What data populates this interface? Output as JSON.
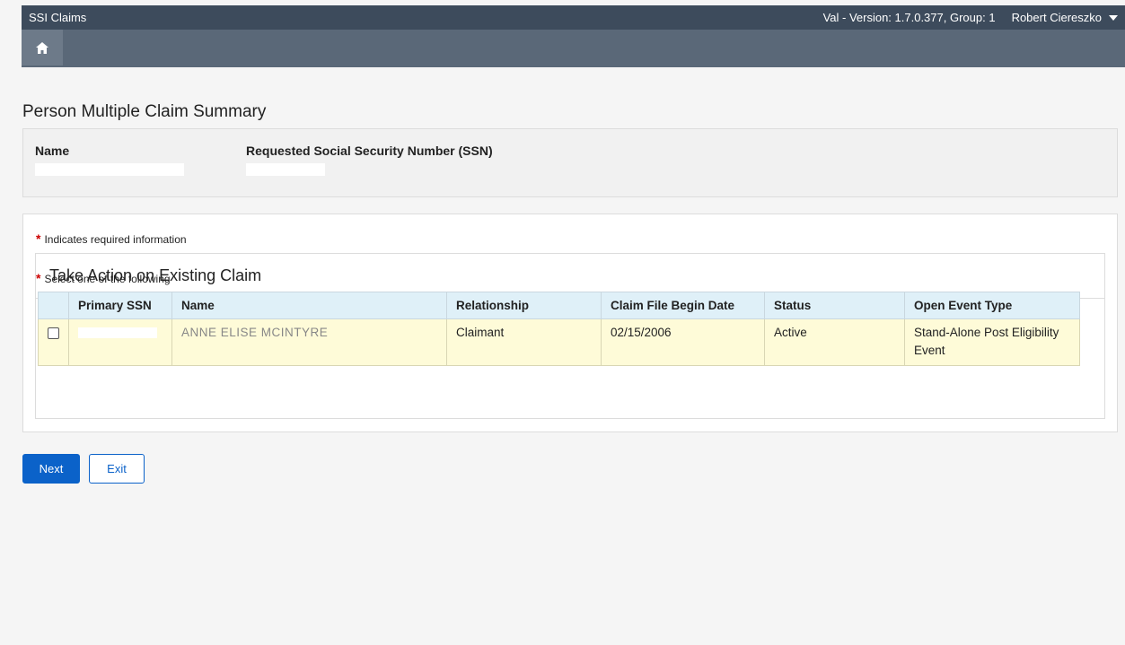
{
  "header": {
    "app_title": "SSI Claims",
    "version_info": "Val - Version: 1.7.0.377, Group: 1",
    "user_name": "Robert Ciereszko"
  },
  "nav": {
    "home_icon": "home-icon"
  },
  "page": {
    "title": "Person Multiple Claim Summary"
  },
  "summary": {
    "name_label": "Name",
    "ssn_label": "Requested Social Security Number (SSN)"
  },
  "form": {
    "required_star": "*",
    "required_note": "Indicates required information",
    "section_title": "Take Action on Existing Claim",
    "select_note": "Select one of the following"
  },
  "table": {
    "columns": [
      "",
      "Primary SSN",
      "Name",
      "Relationship",
      "Claim File Begin Date",
      "Status",
      "Open Event Type"
    ],
    "rows": [
      {
        "primary_ssn": "",
        "name": "ANNE ELISE MCINTYRE",
        "relationship": "Claimant",
        "claim_file_begin_date": "02/15/2006",
        "status": "Active",
        "open_event_type": "Stand-Alone Post Eligibility Event"
      }
    ]
  },
  "buttons": {
    "next_label": "Next",
    "exit_label": "Exit"
  },
  "colors": {
    "primary": "#0b62c9",
    "topbar": "#3d4b5c",
    "navbar": "#5a6878",
    "row_highlight": "#fefbd8",
    "header_row": "#dff0f8"
  }
}
